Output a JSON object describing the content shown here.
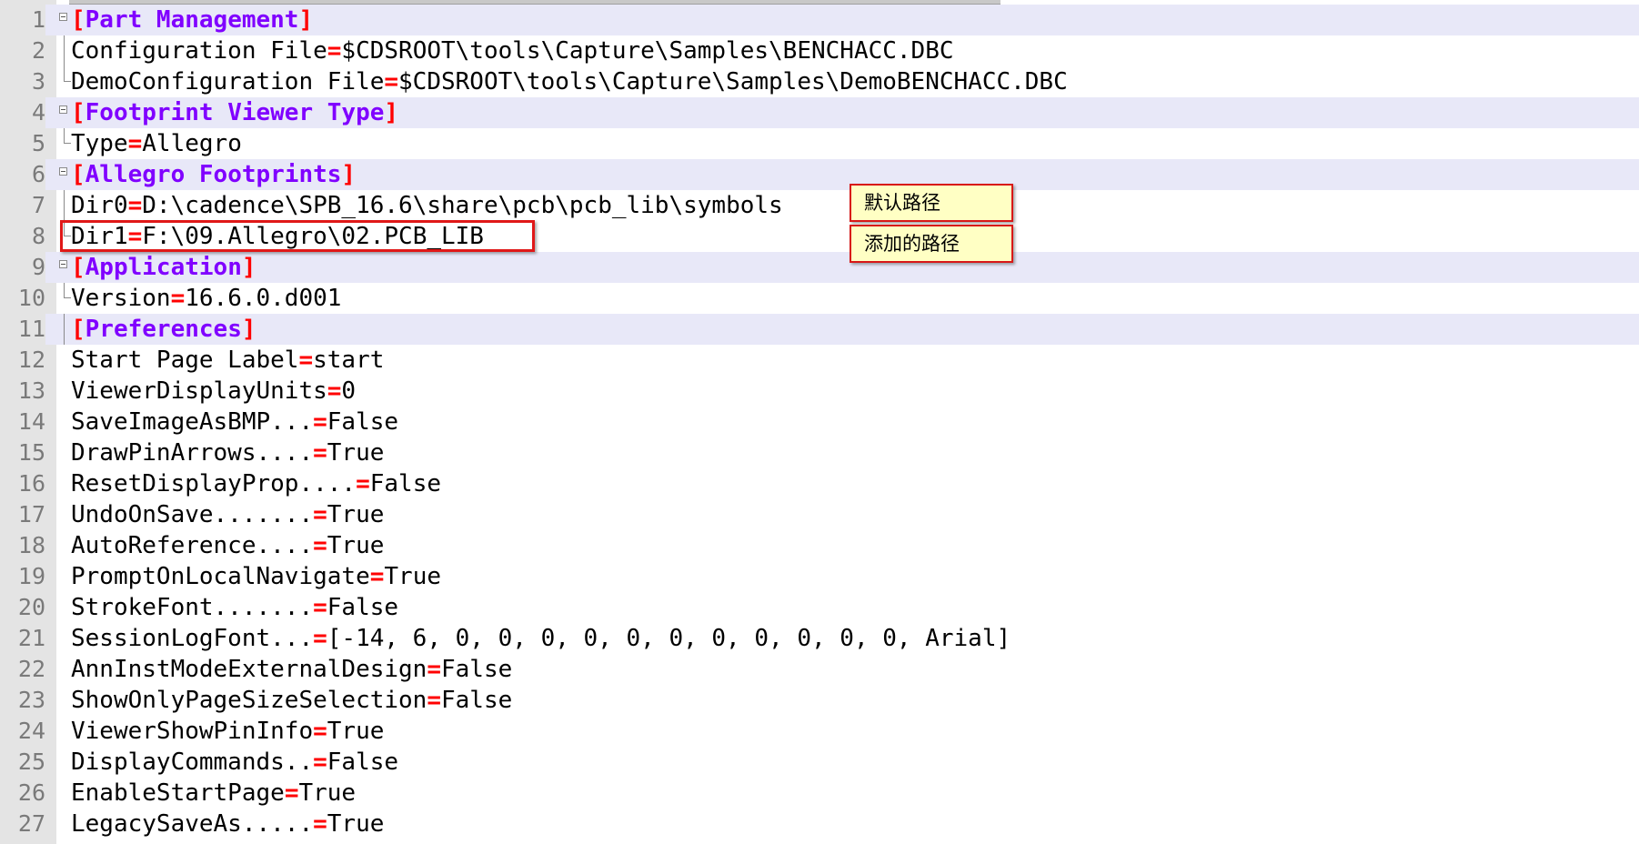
{
  "editor": {
    "lines": [
      {
        "n": "1",
        "kind": "section",
        "open": "[",
        "name": "Part Management",
        "close": "]"
      },
      {
        "n": "2",
        "kind": "kv",
        "key": "Configuration File",
        "eq": "=",
        "value": "$CDSROOT\\tools\\Capture\\Samples\\BENCHACC.DBC"
      },
      {
        "n": "3",
        "kind": "kv",
        "key": "DemoConfiguration File",
        "eq": "=",
        "value": "$CDSROOT\\tools\\Capture\\Samples\\DemoBENCHACC.DBC"
      },
      {
        "n": "4",
        "kind": "section",
        "open": "[",
        "name": "Footprint Viewer Type",
        "close": "]"
      },
      {
        "n": "5",
        "kind": "kv",
        "key": "Type",
        "eq": "=",
        "value": "Allegro"
      },
      {
        "n": "6",
        "kind": "section",
        "open": "[",
        "name": "Allegro Footprints",
        "close": "]"
      },
      {
        "n": "7",
        "kind": "kv",
        "key": "Dir0",
        "eq": "=",
        "value": "D:\\cadence\\SPB_16.6\\share\\pcb\\pcb_lib\\symbols"
      },
      {
        "n": "8",
        "kind": "kv",
        "key": "Dir1",
        "eq": "=",
        "value": "F:\\09.Allegro\\02.PCB_LIB"
      },
      {
        "n": "9",
        "kind": "section",
        "open": "[",
        "name": "Application",
        "close": "]"
      },
      {
        "n": "10",
        "kind": "kv",
        "key": "Version",
        "eq": "=",
        "value": "16.6.0.d001"
      },
      {
        "n": "11",
        "kind": "section",
        "open": "[",
        "name": "Preferences",
        "close": "]"
      },
      {
        "n": "12",
        "kind": "kv",
        "key": "Start Page Label",
        "eq": "=",
        "value": "start"
      },
      {
        "n": "13",
        "kind": "kv",
        "key": "ViewerDisplayUnits",
        "eq": "=",
        "value": "0"
      },
      {
        "n": "14",
        "kind": "kv",
        "key": "SaveImageAsBMP...",
        "eq": "=",
        "value": "False"
      },
      {
        "n": "15",
        "kind": "kv",
        "key": "DrawPinArrows....",
        "eq": "=",
        "value": "True"
      },
      {
        "n": "16",
        "kind": "kv",
        "key": "ResetDisplayProp....",
        "eq": "=",
        "value": "False"
      },
      {
        "n": "17",
        "kind": "kv",
        "key": "UndoOnSave.......",
        "eq": "=",
        "value": "True"
      },
      {
        "n": "18",
        "kind": "kv",
        "key": "AutoReference....",
        "eq": "=",
        "value": "True"
      },
      {
        "n": "19",
        "kind": "kv",
        "key": "PromptOnLocalNavigate",
        "eq": "=",
        "value": "True"
      },
      {
        "n": "20",
        "kind": "kv",
        "key": "StrokeFont.......",
        "eq": "=",
        "value": "False"
      },
      {
        "n": "21",
        "kind": "kv",
        "key": "SessionLogFont...",
        "eq": "=",
        "value": "[-14, 6, 0, 0, 0, 0, 0, 0, 0, 0, 0, 0, 0, Arial]"
      },
      {
        "n": "22",
        "kind": "kv",
        "key": "AnnInstModeExternalDesign",
        "eq": "=",
        "value": "False"
      },
      {
        "n": "23",
        "kind": "kv",
        "key": "ShowOnlyPageSizeSelection",
        "eq": "=",
        "value": "False"
      },
      {
        "n": "24",
        "kind": "kv",
        "key": "ViewerShowPinInfo",
        "eq": "=",
        "value": "True"
      },
      {
        "n": "25",
        "kind": "kv",
        "key": "DisplayCommands..",
        "eq": "=",
        "value": "False"
      },
      {
        "n": "26",
        "kind": "kv",
        "key": "EnableStartPage",
        "eq": "=",
        "value": "True"
      },
      {
        "n": "27",
        "kind": "kv",
        "key": "LegacySaveAs.....",
        "eq": "=",
        "value": "True"
      }
    ]
  },
  "annotations": {
    "default_path": "默认路径",
    "added_path": "添加的路径"
  },
  "colors": {
    "section_header": "#8000ff",
    "operator": "#ff0000",
    "highlight_border": "#e01818",
    "note_background": "#ffffc4"
  }
}
